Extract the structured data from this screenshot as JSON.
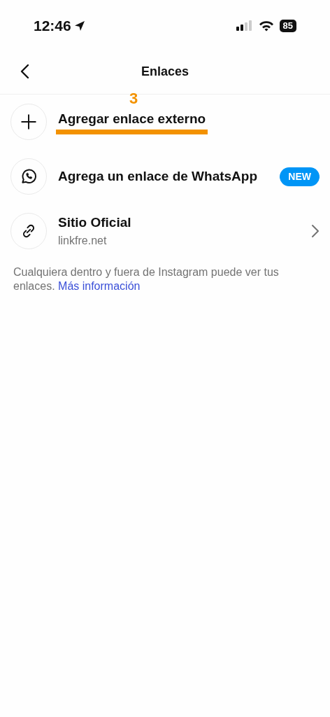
{
  "status_bar": {
    "time": "12:46",
    "battery": "85"
  },
  "header": {
    "title": "Enlaces"
  },
  "annotation": {
    "number": "3"
  },
  "rows": [
    {
      "kind": "add",
      "title": "Agregar enlace externo",
      "annotated": true
    },
    {
      "kind": "whatsapp",
      "title": "Agrega un enlace de WhatsApp",
      "badge": "NEW",
      "annotated": false
    },
    {
      "kind": "link",
      "title": "Sitio Oficial",
      "subtitle": "linkfre.net",
      "annotated": false
    }
  ],
  "footer": {
    "text": "Cualquiera dentro y fuera de Instagram puede ver tus enlaces.",
    "link": "Más información"
  }
}
